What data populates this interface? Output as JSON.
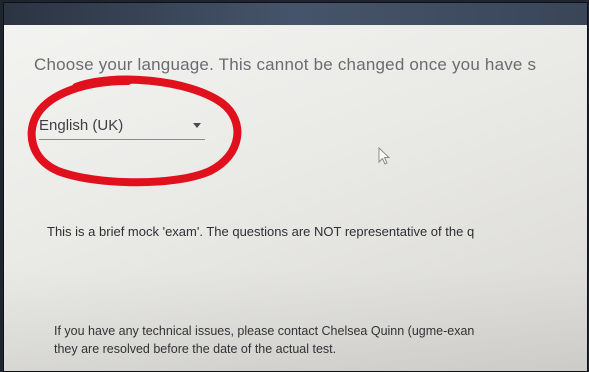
{
  "page": {
    "instruction": "Choose your language. This cannot be changed once you have s",
    "language_select": {
      "value": "English (UK)"
    },
    "mock_note": "This is a brief mock 'exam'. The questions are NOT representative of the q",
    "technical_issues": {
      "line1": "If you have any technical issues, please contact Chelsea Quinn (ugme-exan",
      "line2": "they are resolved before the date of the actual test."
    }
  },
  "annotation": {
    "color": "#e0101c"
  }
}
